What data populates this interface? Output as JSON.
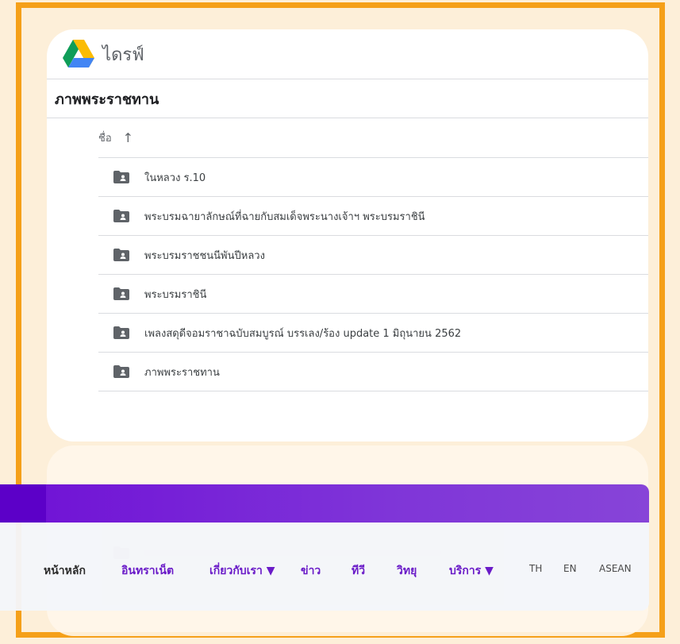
{
  "drive": {
    "app_name": "ไดรฟ์",
    "folder_title": "ภาพพระราชทาน",
    "sort_label": "ชื่อ",
    "sort_icon": "arrow-up-icon",
    "items": [
      {
        "name": "ในหลวง ร.10",
        "icon": "shared-folder-icon"
      },
      {
        "name": "พระบรมฉายาลักษณ์ที่ฉายกับสมเด็จพระนางเจ้าฯ พระบรมราชินี",
        "icon": "shared-folder-icon"
      },
      {
        "name": "พระบรมราชชนนีพันปีหลวง",
        "icon": "shared-folder-icon"
      },
      {
        "name": "พระบรมราชินี",
        "icon": "shared-folder-icon"
      },
      {
        "name": "เพลงสดุดีจอมราชาฉบับสมบูรณ์ บรรเลง/ร้อง update 1 มิถุนายน 2562",
        "icon": "shared-folder-icon"
      },
      {
        "name": "ภาพพระราชทาน",
        "icon": "shared-folder-icon"
      }
    ]
  },
  "nav": {
    "items": [
      {
        "label": "หน้าหลัก"
      },
      {
        "label": "อินทราเน็ต"
      },
      {
        "label": "เกี่ยวกับเรา ▼"
      },
      {
        "label": "ข่าว"
      },
      {
        "label": "ทีวี"
      },
      {
        "label": "วิทยุ"
      },
      {
        "label": "บริการ ▼"
      }
    ],
    "languages": [
      "TH",
      "EN",
      "ASEAN"
    ]
  },
  "colors": {
    "frame_border": "#f5a019",
    "page_background": "#fdefd9",
    "nav_purple": "#6f10d6",
    "nav_text": "#6a1bc8"
  }
}
